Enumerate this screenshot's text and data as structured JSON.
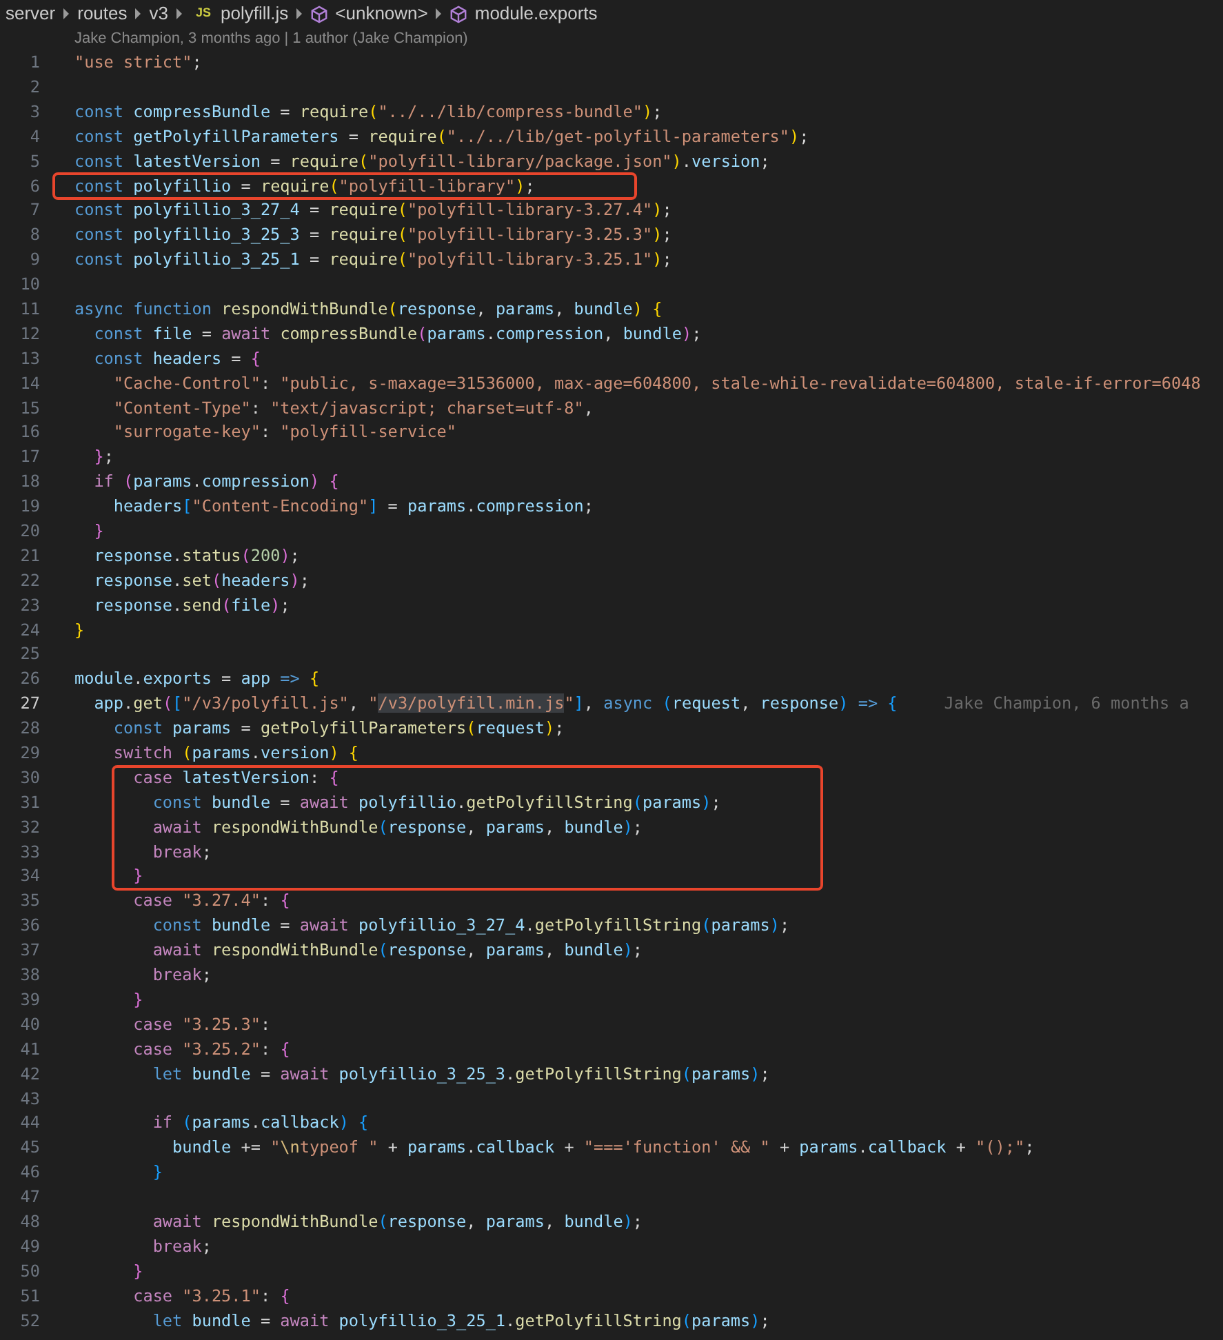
{
  "breadcrumbs": [
    {
      "kind": "folder",
      "label": "server"
    },
    {
      "kind": "folder",
      "label": "routes"
    },
    {
      "kind": "folder",
      "label": "v3"
    },
    {
      "kind": "file",
      "icon": "JS",
      "label": "polyfill.js"
    },
    {
      "kind": "symbol",
      "label": "<unknown>"
    },
    {
      "kind": "symbol",
      "label": "module.exports"
    }
  ],
  "codelens": "Jake Champion, 3 months ago | 1 author (Jake Champion)",
  "blocks": [
    {
      "boxed": false,
      "lines": [
        {
          "number": "1",
          "current": false,
          "tokens": [
            {
              "kind": "str",
              "text": "\"use strict\""
            },
            {
              "kind": "punc",
              "text": ";"
            }
          ]
        },
        {
          "number": "2",
          "current": false
        },
        {
          "number": "3",
          "current": false,
          "tokens": [
            {
              "kind": "kw",
              "text": "const "
            },
            {
              "kind": "var",
              "text": "compressBundle"
            },
            {
              "kind": "punc",
              "text": " = "
            },
            {
              "kind": "fn",
              "text": "require"
            },
            {
              "kind": "br1",
              "text": "("
            },
            {
              "kind": "str",
              "text": "\"../../lib/compress-bundle\""
            },
            {
              "kind": "br1",
              "text": ")"
            },
            {
              "kind": "punc",
              "text": ";"
            }
          ]
        },
        {
          "number": "4",
          "current": false,
          "tokens": [
            {
              "kind": "kw",
              "text": "const "
            },
            {
              "kind": "var",
              "text": "getPolyfillParameters"
            },
            {
              "kind": "punc",
              "text": " = "
            },
            {
              "kind": "fn",
              "text": "require"
            },
            {
              "kind": "br1",
              "text": "("
            },
            {
              "kind": "str",
              "text": "\"../../lib/get-polyfill-parameters\""
            },
            {
              "kind": "br1",
              "text": ")"
            },
            {
              "kind": "punc",
              "text": ";"
            }
          ]
        },
        {
          "number": "5",
          "current": false,
          "tokens": [
            {
              "kind": "kw",
              "text": "const "
            },
            {
              "kind": "var",
              "text": "latestVersion"
            },
            {
              "kind": "punc",
              "text": " = "
            },
            {
              "kind": "fn",
              "text": "require"
            },
            {
              "kind": "br1",
              "text": "("
            },
            {
              "kind": "str",
              "text": "\"polyfill-library/package.json\""
            },
            {
              "kind": "br1",
              "text": ")"
            },
            {
              "kind": "punc",
              "text": "."
            },
            {
              "kind": "var",
              "text": "version"
            },
            {
              "kind": "punc",
              "text": ";"
            }
          ]
        }
      ]
    },
    {
      "boxed": true,
      "lines": [
        {
          "number": "6",
          "current": false,
          "tokens": [
            {
              "kind": "kw",
              "text": "const "
            },
            {
              "kind": "var",
              "text": "polyfillio"
            },
            {
              "kind": "punc",
              "text": " = "
            },
            {
              "kind": "fn",
              "text": "require"
            },
            {
              "kind": "br1",
              "text": "("
            },
            {
              "kind": "str",
              "text": "\"polyfill-library\""
            },
            {
              "kind": "br1",
              "text": ")"
            },
            {
              "kind": "punc",
              "text": ";"
            }
          ]
        }
      ]
    },
    {
      "boxed": false,
      "lines": [
        {
          "number": "7",
          "current": false,
          "tokens": [
            {
              "kind": "kw",
              "text": "const "
            },
            {
              "kind": "var",
              "text": "polyfillio_3_27_4"
            },
            {
              "kind": "punc",
              "text": " = "
            },
            {
              "kind": "fn",
              "text": "require"
            },
            {
              "kind": "br1",
              "text": "("
            },
            {
              "kind": "str",
              "text": "\"polyfill-library-3.27.4\""
            },
            {
              "kind": "br1",
              "text": ")"
            },
            {
              "kind": "punc",
              "text": ";"
            }
          ]
        },
        {
          "number": "8",
          "current": false,
          "tokens": [
            {
              "kind": "kw",
              "text": "const "
            },
            {
              "kind": "var",
              "text": "polyfillio_3_25_3"
            },
            {
              "kind": "punc",
              "text": " = "
            },
            {
              "kind": "fn",
              "text": "require"
            },
            {
              "kind": "br1",
              "text": "("
            },
            {
              "kind": "str",
              "text": "\"polyfill-library-3.25.3\""
            },
            {
              "kind": "br1",
              "text": ")"
            },
            {
              "kind": "punc",
              "text": ";"
            }
          ]
        },
        {
          "number": "9",
          "current": false,
          "tokens": [
            {
              "kind": "kw",
              "text": "const "
            },
            {
              "kind": "var",
              "text": "polyfillio_3_25_1"
            },
            {
              "kind": "punc",
              "text": " = "
            },
            {
              "kind": "fn",
              "text": "require"
            },
            {
              "kind": "br1",
              "text": "("
            },
            {
              "kind": "str",
              "text": "\"polyfill-library-3.25.1\""
            },
            {
              "kind": "br1",
              "text": ")"
            },
            {
              "kind": "punc",
              "text": ";"
            }
          ]
        },
        {
          "number": "10",
          "current": false
        },
        {
          "number": "11",
          "current": false,
          "tokens": [
            {
              "kind": "kw",
              "text": "async function "
            },
            {
              "kind": "fn",
              "text": "respondWithBundle"
            },
            {
              "kind": "br1",
              "text": "("
            },
            {
              "kind": "var",
              "text": "response"
            },
            {
              "kind": "punc",
              "text": ", "
            },
            {
              "kind": "var",
              "text": "params"
            },
            {
              "kind": "punc",
              "text": ", "
            },
            {
              "kind": "var",
              "text": "bundle"
            },
            {
              "kind": "br1",
              "text": ") {"
            }
          ]
        },
        {
          "number": "12",
          "current": false,
          "tokens": [
            {
              "kind": "kw",
              "text": "  const "
            },
            {
              "kind": "var",
              "text": "file"
            },
            {
              "kind": "punc",
              "text": " = "
            },
            {
              "kind": "ctl",
              "text": "await "
            },
            {
              "kind": "fn",
              "text": "compressBundle"
            },
            {
              "kind": "br2",
              "text": "("
            },
            {
              "kind": "var",
              "text": "params"
            },
            {
              "kind": "punc",
              "text": "."
            },
            {
              "kind": "var",
              "text": "compression"
            },
            {
              "kind": "punc",
              "text": ", "
            },
            {
              "kind": "var",
              "text": "bundle"
            },
            {
              "kind": "br2",
              "text": ")"
            },
            {
              "kind": "punc",
              "text": ";"
            }
          ]
        },
        {
          "number": "13",
          "current": false,
          "tokens": [
            {
              "kind": "kw",
              "text": "  const "
            },
            {
              "kind": "var",
              "text": "headers"
            },
            {
              "kind": "punc",
              "text": " = "
            },
            {
              "kind": "br2",
              "text": "{"
            }
          ]
        },
        {
          "number": "14",
          "current": false,
          "tokens": [
            {
              "kind": "str",
              "text": "    \"Cache-Control\""
            },
            {
              "kind": "punc",
              "text": ": "
            },
            {
              "kind": "str",
              "text": "\"public, s-maxage=31536000, max-age=604800, stale-while-revalidate=604800, stale-if-error=6048"
            }
          ]
        },
        {
          "number": "15",
          "current": false,
          "tokens": [
            {
              "kind": "str",
              "text": "    \"Content-Type\""
            },
            {
              "kind": "punc",
              "text": ": "
            },
            {
              "kind": "str",
              "text": "\"text/javascript; charset=utf-8\""
            },
            {
              "kind": "punc",
              "text": ","
            }
          ]
        },
        {
          "number": "16",
          "current": false,
          "tokens": [
            {
              "kind": "str",
              "text": "    \"surrogate-key\""
            },
            {
              "kind": "punc",
              "text": ": "
            },
            {
              "kind": "str",
              "text": "\"polyfill-service\""
            }
          ]
        },
        {
          "number": "17",
          "current": false,
          "tokens": [
            {
              "kind": "br2",
              "text": "  }"
            },
            {
              "kind": "punc",
              "text": ";"
            }
          ]
        },
        {
          "number": "18",
          "current": false,
          "tokens": [
            {
              "kind": "ctl",
              "text": "  if "
            },
            {
              "kind": "br2",
              "text": "("
            },
            {
              "kind": "var",
              "text": "params"
            },
            {
              "kind": "punc",
              "text": "."
            },
            {
              "kind": "var",
              "text": "compression"
            },
            {
              "kind": "br2",
              "text": ") {"
            }
          ]
        },
        {
          "number": "19",
          "current": false,
          "tokens": [
            {
              "kind": "var",
              "text": "    headers"
            },
            {
              "kind": "br3",
              "text": "["
            },
            {
              "kind": "str",
              "text": "\"Content-Encoding\""
            },
            {
              "kind": "br3",
              "text": "]"
            },
            {
              "kind": "punc",
              "text": " = "
            },
            {
              "kind": "var",
              "text": "params"
            },
            {
              "kind": "punc",
              "text": "."
            },
            {
              "kind": "var",
              "text": "compression"
            },
            {
              "kind": "punc",
              "text": ";"
            }
          ]
        },
        {
          "number": "20",
          "current": false,
          "tokens": [
            {
              "kind": "br2",
              "text": "  }"
            }
          ]
        },
        {
          "number": "21",
          "current": false,
          "tokens": [
            {
              "kind": "var",
              "text": "  response"
            },
            {
              "kind": "punc",
              "text": "."
            },
            {
              "kind": "fn",
              "text": "status"
            },
            {
              "kind": "br2",
              "text": "("
            },
            {
              "kind": "num",
              "text": "200"
            },
            {
              "kind": "br2",
              "text": ")"
            },
            {
              "kind": "punc",
              "text": ";"
            }
          ]
        },
        {
          "number": "22",
          "current": false,
          "tokens": [
            {
              "kind": "var",
              "text": "  response"
            },
            {
              "kind": "punc",
              "text": "."
            },
            {
              "kind": "fn",
              "text": "set"
            },
            {
              "kind": "br2",
              "text": "("
            },
            {
              "kind": "var",
              "text": "headers"
            },
            {
              "kind": "br2",
              "text": ")"
            },
            {
              "kind": "punc",
              "text": ";"
            }
          ]
        },
        {
          "number": "23",
          "current": false,
          "tokens": [
            {
              "kind": "var",
              "text": "  response"
            },
            {
              "kind": "punc",
              "text": "."
            },
            {
              "kind": "fn",
              "text": "send"
            },
            {
              "kind": "br2",
              "text": "("
            },
            {
              "kind": "var",
              "text": "file"
            },
            {
              "kind": "br2",
              "text": ")"
            },
            {
              "kind": "punc",
              "text": ";"
            }
          ]
        },
        {
          "number": "24",
          "current": false,
          "tokens": [
            {
              "kind": "br1",
              "text": "}"
            }
          ]
        },
        {
          "number": "25",
          "current": false
        },
        {
          "number": "26",
          "current": false,
          "tokens": [
            {
              "kind": "var",
              "text": "module"
            },
            {
              "kind": "punc",
              "text": "."
            },
            {
              "kind": "var",
              "text": "exports"
            },
            {
              "kind": "punc",
              "text": " = "
            },
            {
              "kind": "var",
              "text": "app"
            },
            {
              "kind": "kw",
              "text": " => "
            },
            {
              "kind": "br1",
              "text": "{"
            }
          ]
        },
        {
          "number": "27",
          "current": true,
          "blame": "Jake Champion, 6 months a",
          "tokens": [
            {
              "kind": "var",
              "text": "  app"
            },
            {
              "kind": "punc",
              "text": "."
            },
            {
              "kind": "fn",
              "text": "get"
            },
            {
              "kind": "br2",
              "text": "("
            },
            {
              "kind": "br3",
              "text": "["
            },
            {
              "kind": "str",
              "text": "\"/v3/polyfill.js\""
            },
            {
              "kind": "punc",
              "text": ", "
            },
            {
              "kind": "str",
              "text": "\""
            },
            {
              "kind": "sel",
              "text": "/v3/polyfill.min.js"
            },
            {
              "kind": "str",
              "text": "\""
            },
            {
              "kind": "br3",
              "text": "]"
            },
            {
              "kind": "punc",
              "text": ", "
            },
            {
              "kind": "kw",
              "text": "async "
            },
            {
              "kind": "br3",
              "text": "("
            },
            {
              "kind": "var",
              "text": "request"
            },
            {
              "kind": "punc",
              "text": ", "
            },
            {
              "kind": "var",
              "text": "response"
            },
            {
              "kind": "br3",
              "text": ")"
            },
            {
              "kind": "kw",
              "text": " => "
            },
            {
              "kind": "br3",
              "text": "{"
            }
          ]
        },
        {
          "number": "28",
          "current": false,
          "tokens": [
            {
              "kind": "kw",
              "text": "    const "
            },
            {
              "kind": "var",
              "text": "params"
            },
            {
              "kind": "punc",
              "text": " = "
            },
            {
              "kind": "fn",
              "text": "getPolyfillParameters"
            },
            {
              "kind": "br1",
              "text": "("
            },
            {
              "kind": "var",
              "text": "request"
            },
            {
              "kind": "br1",
              "text": ")"
            },
            {
              "kind": "punc",
              "text": ";"
            }
          ]
        },
        {
          "number": "29",
          "current": false,
          "tokens": [
            {
              "kind": "ctl",
              "text": "    switch "
            },
            {
              "kind": "br1",
              "text": "("
            },
            {
              "kind": "var",
              "text": "params"
            },
            {
              "kind": "punc",
              "text": "."
            },
            {
              "kind": "var",
              "text": "version"
            },
            {
              "kind": "br1",
              "text": ") {"
            }
          ]
        }
      ]
    },
    {
      "boxed": true,
      "lines": [
        {
          "number": "30",
          "current": false,
          "tokens": [
            {
              "kind": "ctl",
              "text": "      case "
            },
            {
              "kind": "var",
              "text": "latestVersion"
            },
            {
              "kind": "punc",
              "text": ": "
            },
            {
              "kind": "br2",
              "text": "{"
            }
          ]
        },
        {
          "number": "31",
          "current": false,
          "tokens": [
            {
              "kind": "kw",
              "text": "        const "
            },
            {
              "kind": "var",
              "text": "bundle"
            },
            {
              "kind": "punc",
              "text": " = "
            },
            {
              "kind": "ctl",
              "text": "await "
            },
            {
              "kind": "var",
              "text": "polyfillio"
            },
            {
              "kind": "punc",
              "text": "."
            },
            {
              "kind": "fn",
              "text": "getPolyfillString"
            },
            {
              "kind": "br3",
              "text": "("
            },
            {
              "kind": "var",
              "text": "params"
            },
            {
              "kind": "br3",
              "text": ")"
            },
            {
              "kind": "punc",
              "text": ";"
            }
          ]
        },
        {
          "number": "32",
          "current": false,
          "tokens": [
            {
              "kind": "ctl",
              "text": "        await "
            },
            {
              "kind": "fn",
              "text": "respondWithBundle"
            },
            {
              "kind": "br3",
              "text": "("
            },
            {
              "kind": "var",
              "text": "response"
            },
            {
              "kind": "punc",
              "text": ", "
            },
            {
              "kind": "var",
              "text": "params"
            },
            {
              "kind": "punc",
              "text": ", "
            },
            {
              "kind": "var",
              "text": "bundle"
            },
            {
              "kind": "br3",
              "text": ")"
            },
            {
              "kind": "punc",
              "text": ";"
            }
          ]
        },
        {
          "number": "33",
          "current": false,
          "tokens": [
            {
              "kind": "ctl",
              "text": "        break"
            },
            {
              "kind": "punc",
              "text": ";"
            }
          ]
        },
        {
          "number": "34",
          "current": false,
          "tokens": [
            {
              "kind": "br2",
              "text": "      }"
            }
          ]
        }
      ]
    },
    {
      "boxed": false,
      "lines": [
        {
          "number": "35",
          "current": false,
          "tokens": [
            {
              "kind": "ctl",
              "text": "      case "
            },
            {
              "kind": "str",
              "text": "\"3.27.4\""
            },
            {
              "kind": "punc",
              "text": ": "
            },
            {
              "kind": "br2",
              "text": "{"
            }
          ]
        },
        {
          "number": "36",
          "current": false,
          "tokens": [
            {
              "kind": "kw",
              "text": "        const "
            },
            {
              "kind": "var",
              "text": "bundle"
            },
            {
              "kind": "punc",
              "text": " = "
            },
            {
              "kind": "ctl",
              "text": "await "
            },
            {
              "kind": "var",
              "text": "polyfillio_3_27_4"
            },
            {
              "kind": "punc",
              "text": "."
            },
            {
              "kind": "fn",
              "text": "getPolyfillString"
            },
            {
              "kind": "br3",
              "text": "("
            },
            {
              "kind": "var",
              "text": "params"
            },
            {
              "kind": "br3",
              "text": ")"
            },
            {
              "kind": "punc",
              "text": ";"
            }
          ]
        },
        {
          "number": "37",
          "current": false,
          "tokens": [
            {
              "kind": "ctl",
              "text": "        await "
            },
            {
              "kind": "fn",
              "text": "respondWithBundle"
            },
            {
              "kind": "br3",
              "text": "("
            },
            {
              "kind": "var",
              "text": "response"
            },
            {
              "kind": "punc",
              "text": ", "
            },
            {
              "kind": "var",
              "text": "params"
            },
            {
              "kind": "punc",
              "text": ", "
            },
            {
              "kind": "var",
              "text": "bundle"
            },
            {
              "kind": "br3",
              "text": ")"
            },
            {
              "kind": "punc",
              "text": ";"
            }
          ]
        },
        {
          "number": "38",
          "current": false,
          "tokens": [
            {
              "kind": "ctl",
              "text": "        break"
            },
            {
              "kind": "punc",
              "text": ";"
            }
          ]
        },
        {
          "number": "39",
          "current": false,
          "tokens": [
            {
              "kind": "br2",
              "text": "      }"
            }
          ]
        },
        {
          "number": "40",
          "current": false,
          "tokens": [
            {
              "kind": "ctl",
              "text": "      case "
            },
            {
              "kind": "str",
              "text": "\"3.25.3\""
            },
            {
              "kind": "punc",
              "text": ":"
            }
          ]
        },
        {
          "number": "41",
          "current": false,
          "tokens": [
            {
              "kind": "ctl",
              "text": "      case "
            },
            {
              "kind": "str",
              "text": "\"3.25.2\""
            },
            {
              "kind": "punc",
              "text": ": "
            },
            {
              "kind": "br2",
              "text": "{"
            }
          ]
        },
        {
          "number": "42",
          "current": false,
          "tokens": [
            {
              "kind": "kw",
              "text": "        let "
            },
            {
              "kind": "var",
              "text": "bundle"
            },
            {
              "kind": "punc",
              "text": " = "
            },
            {
              "kind": "ctl",
              "text": "await "
            },
            {
              "kind": "var",
              "text": "polyfillio_3_25_3"
            },
            {
              "kind": "punc",
              "text": "."
            },
            {
              "kind": "fn",
              "text": "getPolyfillString"
            },
            {
              "kind": "br3",
              "text": "("
            },
            {
              "kind": "var",
              "text": "params"
            },
            {
              "kind": "br3",
              "text": ")"
            },
            {
              "kind": "punc",
              "text": ";"
            }
          ]
        },
        {
          "number": "43",
          "current": false
        },
        {
          "number": "44",
          "current": false,
          "tokens": [
            {
              "kind": "ctl",
              "text": "        if "
            },
            {
              "kind": "br3",
              "text": "("
            },
            {
              "kind": "var",
              "text": "params"
            },
            {
              "kind": "punc",
              "text": "."
            },
            {
              "kind": "var",
              "text": "callback"
            },
            {
              "kind": "br3",
              "text": ") {"
            }
          ]
        },
        {
          "number": "45",
          "current": false,
          "tokens": [
            {
              "kind": "var",
              "text": "          bundle"
            },
            {
              "kind": "punc",
              "text": " += "
            },
            {
              "kind": "str",
              "text": "\""
            },
            {
              "kind": "esc",
              "text": "\\n"
            },
            {
              "kind": "str",
              "text": "typeof \""
            },
            {
              "kind": "punc",
              "text": " + "
            },
            {
              "kind": "var",
              "text": "params"
            },
            {
              "kind": "punc",
              "text": "."
            },
            {
              "kind": "var",
              "text": "callback"
            },
            {
              "kind": "punc",
              "text": " + "
            },
            {
              "kind": "str",
              "text": "\"==='function' && \""
            },
            {
              "kind": "punc",
              "text": " + "
            },
            {
              "kind": "var",
              "text": "params"
            },
            {
              "kind": "punc",
              "text": "."
            },
            {
              "kind": "var",
              "text": "callback"
            },
            {
              "kind": "punc",
              "text": " + "
            },
            {
              "kind": "str",
              "text": "\"();\""
            },
            {
              "kind": "punc",
              "text": ";"
            }
          ]
        },
        {
          "number": "46",
          "current": false,
          "tokens": [
            {
              "kind": "br3",
              "text": "        }"
            }
          ]
        },
        {
          "number": "47",
          "current": false
        },
        {
          "number": "48",
          "current": false,
          "tokens": [
            {
              "kind": "ctl",
              "text": "        await "
            },
            {
              "kind": "fn",
              "text": "respondWithBundle"
            },
            {
              "kind": "br3",
              "text": "("
            },
            {
              "kind": "var",
              "text": "response"
            },
            {
              "kind": "punc",
              "text": ", "
            },
            {
              "kind": "var",
              "text": "params"
            },
            {
              "kind": "punc",
              "text": ", "
            },
            {
              "kind": "var",
              "text": "bundle"
            },
            {
              "kind": "br3",
              "text": ")"
            },
            {
              "kind": "punc",
              "text": ";"
            }
          ]
        },
        {
          "number": "49",
          "current": false,
          "tokens": [
            {
              "kind": "ctl",
              "text": "        break"
            },
            {
              "kind": "punc",
              "text": ";"
            }
          ]
        },
        {
          "number": "50",
          "current": false,
          "tokens": [
            {
              "kind": "br2",
              "text": "      }"
            }
          ]
        },
        {
          "number": "51",
          "current": false,
          "tokens": [
            {
              "kind": "ctl",
              "text": "      case "
            },
            {
              "kind": "str",
              "text": "\"3.25.1\""
            },
            {
              "kind": "punc",
              "text": ": "
            },
            {
              "kind": "br2",
              "text": "{"
            }
          ]
        },
        {
          "number": "52",
          "current": false,
          "tokens": [
            {
              "kind": "kw",
              "text": "        let "
            },
            {
              "kind": "var",
              "text": "bundle"
            },
            {
              "kind": "punc",
              "text": " = "
            },
            {
              "kind": "ctl",
              "text": "await "
            },
            {
              "kind": "var",
              "text": "polyfillio_3_25_1"
            },
            {
              "kind": "punc",
              "text": "."
            },
            {
              "kind": "fn",
              "text": "getPolyfillString"
            },
            {
              "kind": "br3",
              "text": "("
            },
            {
              "kind": "var",
              "text": "params"
            },
            {
              "kind": "br3",
              "text": ")"
            },
            {
              "kind": "punc",
              "text": ";"
            }
          ]
        }
      ]
    }
  ]
}
